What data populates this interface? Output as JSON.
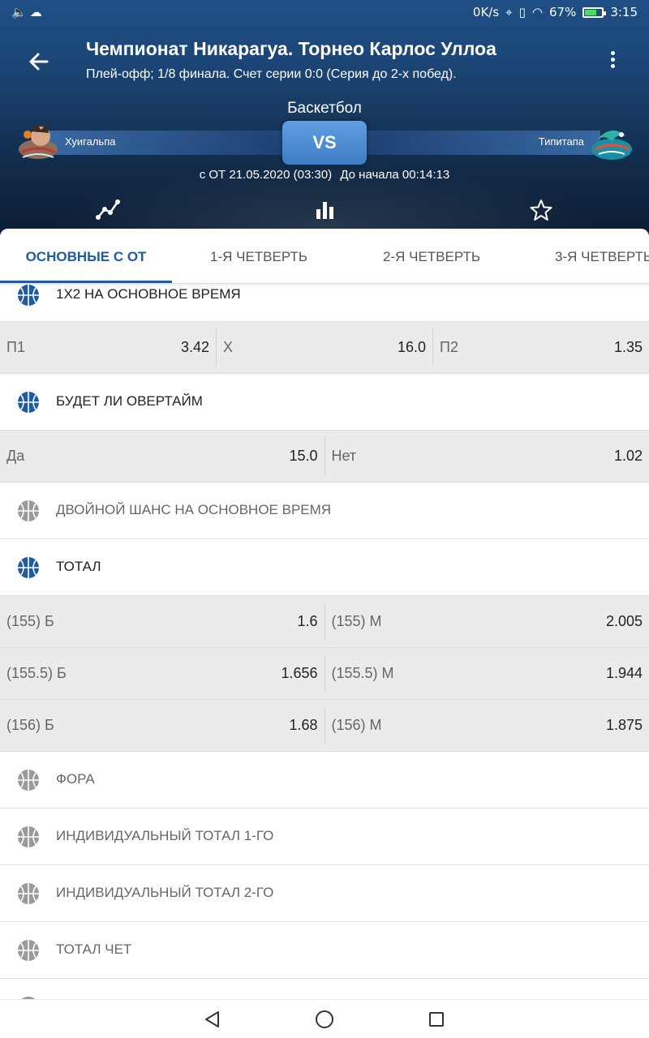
{
  "status_bar": {
    "speed": "0K/s",
    "battery": "67%",
    "battery_level": 0.67,
    "time": "3:15"
  },
  "header": {
    "title": "Чемпионат Никарагуа. Торнео Карлос Уллоа",
    "subtitle": "Плей-офф; 1/8 финала. Счет серии 0:0 (Серия до 2-х побед).",
    "sport": "Баскетбол",
    "team1": "Хуигальпа",
    "team2": "Типитапа",
    "vs": "VS",
    "date": "с ОТ 21.05.2020 (03:30)",
    "countdown": "До начала 00:14:13"
  },
  "tabs": [
    {
      "label": "ОСНОВНЫЕ С ОТ"
    },
    {
      "label": "1-Я ЧЕТВЕРТЬ"
    },
    {
      "label": "2-Я ЧЕТВЕРТЬ"
    },
    {
      "label": "3-Я ЧЕТВЕРТЬ"
    }
  ],
  "markets": {
    "m1x2": {
      "title": "1Х2 НА ОСНОВНОЕ ВРЕМЯ",
      "odds": [
        {
          "name": "П1",
          "value": "3.42"
        },
        {
          "name": "Х",
          "value": "16.0"
        },
        {
          "name": "П2",
          "value": "1.35"
        }
      ]
    },
    "overtime": {
      "title": "БУДЕТ ЛИ ОВЕРТАЙМ",
      "odds": [
        {
          "name": "Да",
          "value": "15.0"
        },
        {
          "name": "Нет",
          "value": "1.02"
        }
      ]
    },
    "double_chance": {
      "title": "ДВОЙНОЙ ШАНС НА ОСНОВНОЕ ВРЕМЯ"
    },
    "total": {
      "title": "ТОТАЛ",
      "rows": [
        [
          {
            "name": "(155) Б",
            "value": "1.6"
          },
          {
            "name": "(155) М",
            "value": "2.005"
          }
        ],
        [
          {
            "name": "(155.5) Б",
            "value": "1.656"
          },
          {
            "name": "(155.5) М",
            "value": "1.944"
          }
        ],
        [
          {
            "name": "(156) Б",
            "value": "1.68"
          },
          {
            "name": "(156) М",
            "value": "1.875"
          }
        ]
      ]
    },
    "handicap": {
      "title": "ФОРА"
    },
    "ind_total_1": {
      "title": "ИНДИВИДУАЛЬНЫЙ ТОТАЛ 1-ГО"
    },
    "ind_total_2": {
      "title": "ИНДИВИДУАЛЬНЫЙ ТОТАЛ 2-ГО"
    },
    "total_even": {
      "title": "ТОТАЛ ЧЕТ"
    }
  },
  "colors": {
    "accent": "#1f5aa3",
    "header_bg": "#1c4677",
    "vs_button": "#4a8bd4",
    "odds_bg": "#ebebeb"
  },
  "icons": {
    "back": "arrow-left-icon",
    "menu": "more-vertical-icon",
    "trend": "line-chart-icon",
    "stats": "bar-chart-icon",
    "favorite": "star-icon",
    "ball": "basketball-icon"
  }
}
